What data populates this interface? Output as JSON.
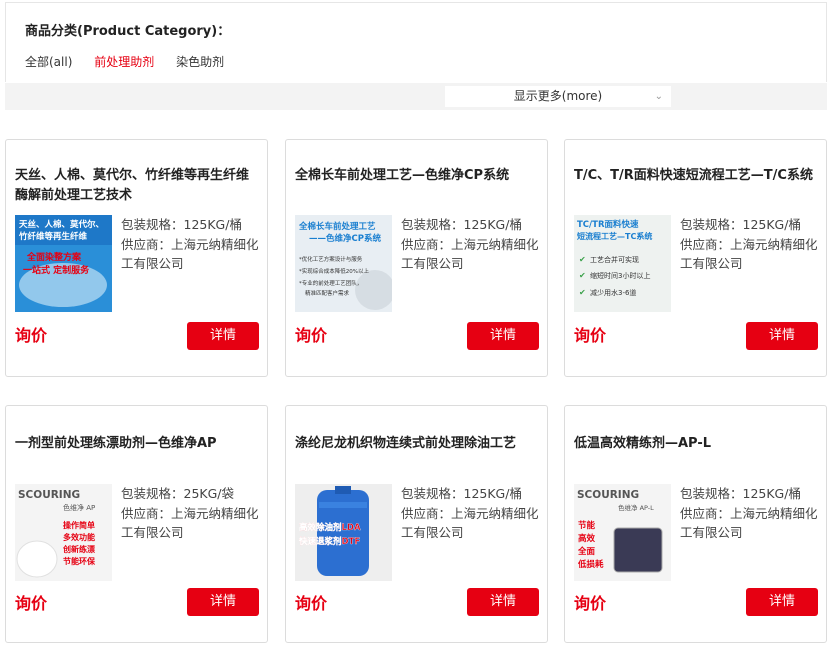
{
  "category": {
    "title": "商品分类(Product Category)：",
    "filters": [
      "全部(all)",
      "前处理助剂",
      "染色助剂"
    ],
    "active_filter": "前处理助剂",
    "more_label": "显示更多(more)"
  },
  "products": [
    {
      "title": "天丝、人棉、莫代尔、竹纤维等再生纤维 酶解前处理工艺技术",
      "spec": "包装规格：125KG/桶",
      "supplier": "供应商：上海元纳精细化工有限公司",
      "price": "询价",
      "button": "详情",
      "image_text": [
        "天丝、人棉、莫代尔、",
        "竹纤维等再生纤维",
        "全面染整方案",
        "一站式 定制服务"
      ]
    },
    {
      "title": "全棉长车前处理工艺—色维净CP系统",
      "spec": "包装规格：125KG/桶",
      "supplier": "供应商：上海元纳精细化工有限公司",
      "price": "询价",
      "button": "详情",
      "image_text": [
        "全棉长车前处理工艺",
        "——色维净CP系统",
        "*优化工艺方案设计与服务",
        "*实现综合成本降低20%以上",
        "*专业的前处理工艺团队，",
        "精准匹配客户需求"
      ]
    },
    {
      "title": "T/C、T/R面料快速短流程工艺—T/C系统",
      "spec": "包装规格：125KG/桶",
      "supplier": "供应商：上海元纳精细化工有限公司",
      "price": "询价",
      "button": "详情",
      "image_text": [
        "TC/TR面料快速",
        "短流程工艺—TC系统",
        "工艺合并可实现",
        "缩短时间3小时以上",
        "减少用水3-6道"
      ]
    },
    {
      "title": "一剂型前处理练漂助剂—色维净AP",
      "spec": "包装规格：25KG/袋",
      "supplier": "供应商：上海元纳精细化工有限公司",
      "price": "询价",
      "button": "详情",
      "image_text": [
        "SCOURING",
        "色维净 AP",
        "操作简单",
        "多效功能",
        "创新练漂",
        "节能环保"
      ]
    },
    {
      "title": "涤纶尼龙机织物连续式前处理除油工艺",
      "spec": "包装规格：125KG/桶",
      "supplier": "供应商：上海元纳精细化工有限公司",
      "price": "询价",
      "button": "详情",
      "image_text": [
        "高效除油剂LDA",
        "快速退浆剂DTF"
      ]
    },
    {
      "title": "低温高效精练剂—AP-L",
      "spec": "包装规格：125KG/桶",
      "supplier": "供应商：上海元纳精细化工有限公司",
      "price": "询价",
      "button": "详情",
      "image_text": [
        "SCOURING",
        "色维净 AP-L",
        "节能",
        "高效",
        "全面",
        "低损耗"
      ]
    }
  ],
  "colors": {
    "accent": "#e60012",
    "border": "#dcdcdc",
    "bar_bg": "#f3f3f3"
  }
}
